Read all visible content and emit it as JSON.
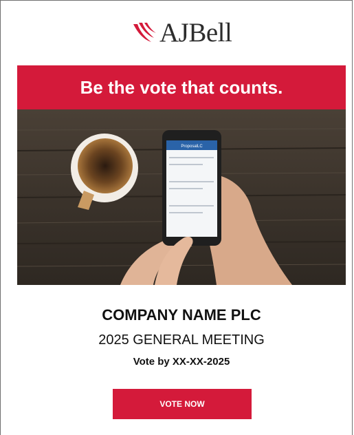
{
  "brand": {
    "name": "AJBell",
    "accent_color": "#d41a3a"
  },
  "banner": {
    "headline": "Be the vote that counts."
  },
  "hero": {
    "alt": "Hand holding a phone showing a voting screen next to a cup of coffee on a wooden table",
    "phone_app_title": "ProposalLC"
  },
  "meeting": {
    "company": "COMPANY NAME PLC",
    "title": "2025 GENERAL MEETING",
    "deadline": "Vote by XX-XX-2025"
  },
  "cta": {
    "label": "VOTE NOW"
  }
}
